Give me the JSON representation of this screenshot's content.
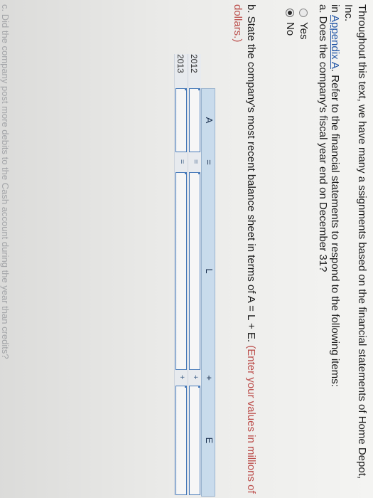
{
  "intro": {
    "part1": "Throughout this text, we have many a ssignments based on the financial statements of Home Depot, Inc.",
    "part2a": "in ",
    "link": "Appendix A",
    "part2b": ". Refer to the financial statements to respond to the following items:"
  },
  "question_a": {
    "text": "a. Does the company's fiscal year end on December 31?",
    "options": [
      {
        "label": "Yes",
        "selected": false
      },
      {
        "label": "No",
        "selected": true
      }
    ]
  },
  "question_b": {
    "text": "b. State the company's most recent balance sheet in terms of A = L + E. ",
    "hint": "(Enter your values in millions of dollars.)"
  },
  "balance_table": {
    "headers": [
      "A",
      "=",
      "L",
      "+",
      "E"
    ],
    "rows": [
      {
        "year": "2012",
        "eq": "=",
        "plus": "+"
      },
      {
        "year": "2013",
        "eq": "=",
        "plus": "+"
      }
    ]
  },
  "question_c": {
    "text": "c. Did the company post more debits to the Cash account during the year than credits?"
  }
}
